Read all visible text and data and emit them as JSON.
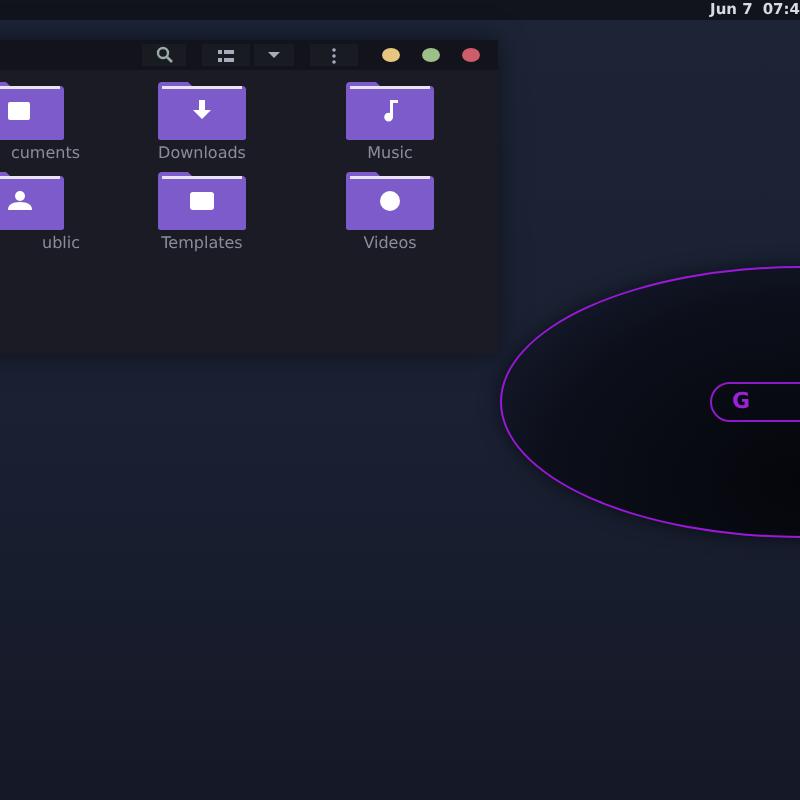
{
  "top_bar": {
    "date": "Jun 7",
    "time": "07:4"
  },
  "folders": [
    {
      "label": "cuments",
      "kind": "documents"
    },
    {
      "label": "Downloads",
      "kind": "downloads"
    },
    {
      "label": "Music",
      "kind": "music"
    },
    {
      "label": "ublic",
      "kind": "public"
    },
    {
      "label": "Templates",
      "kind": "templates"
    },
    {
      "label": "Videos",
      "kind": "videos"
    }
  ],
  "wallpaper": {
    "logo_text": "G"
  }
}
